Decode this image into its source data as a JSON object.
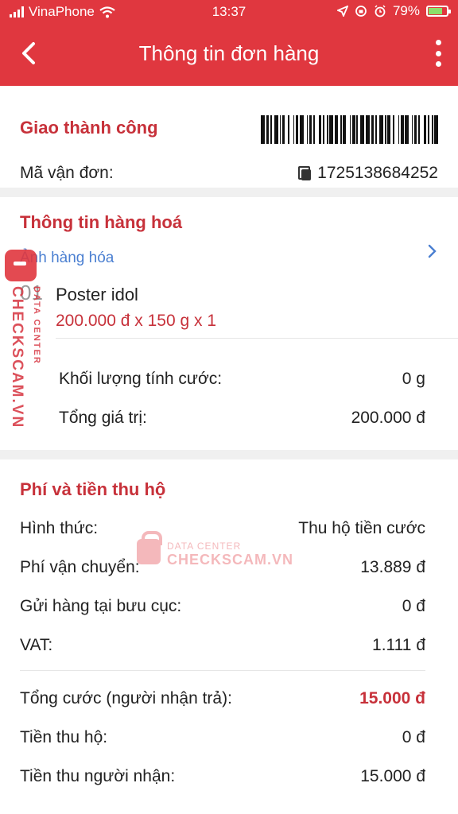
{
  "status_bar": {
    "carrier": "VinaPhone",
    "time": "13:37",
    "battery": "79%",
    "battery_level": 0.79
  },
  "header": {
    "title": "Thông tin đơn hàng"
  },
  "order": {
    "status": "Giao thành công",
    "tracking_label": "Mã vận đơn:",
    "tracking_number": "1725138684252"
  },
  "goods": {
    "section_title": "Thông tin hàng hoá",
    "photo_label": "Ảnh hàng hóa",
    "items": [
      {
        "index": "01",
        "name": "Poster idol",
        "price_line": "200.000 đ x 150 g x 1"
      }
    ],
    "weight_label": "Khối lượng tính cước:",
    "weight_value": "0 g",
    "total_value_label": "Tổng giá trị:",
    "total_value": "200.000 đ"
  },
  "fees": {
    "section_title": "Phí và tiền thu hộ",
    "rows": [
      {
        "label": "Hình thức:",
        "value": "Thu hộ tiền cước"
      },
      {
        "label": "Phí vận chuyển:",
        "value": "13.889 đ"
      },
      {
        "label": "Gửi hàng tại bưu cục:",
        "value": "0 đ"
      },
      {
        "label": "VAT:",
        "value": "1.111 đ"
      }
    ],
    "total_label": "Tổng cước (người nhận trả):",
    "total_value": "15.000 đ",
    "cod_label": "Tiền thu hộ:",
    "cod_value": "0 đ",
    "receiver_label": "Tiền thu người nhận:",
    "receiver_value": "15.000 đ"
  },
  "watermark": {
    "small_text": "DATA CENTER",
    "brand_text": "CHECKSCAM.VN"
  },
  "colors": {
    "primary": "#e0373f",
    "accent_text": "#c7313a",
    "link": "#4a7fd1"
  }
}
